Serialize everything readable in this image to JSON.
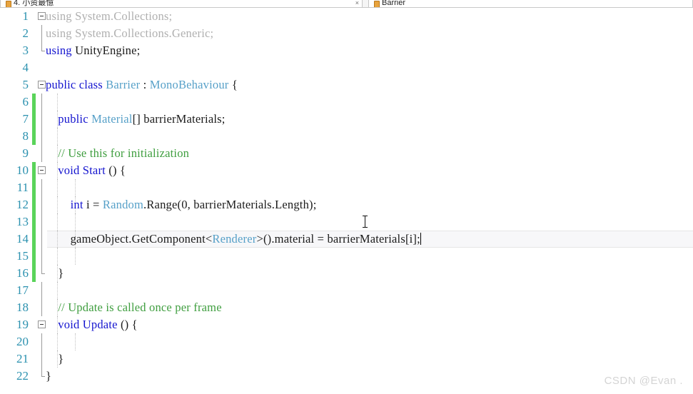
{
  "window": {
    "tabs": [
      {
        "label": "4. 小资最憶",
        "icon": "document-icon",
        "active": false,
        "close_label": "×"
      },
      {
        "label": "Barrier",
        "icon": "csharp-file-icon",
        "active": true,
        "close_label": ""
      }
    ]
  },
  "editor": {
    "file_name": "Barrier",
    "language": "csharp",
    "current_line": 14,
    "colors": {
      "keyword": "#1414cf",
      "type": "#56a0c8",
      "comment": "#3f9e3f",
      "plain": "#1a1a1a",
      "dimmed": "#b0b0b0",
      "line_number": "#2b91af",
      "change_bar": "#5ad45a",
      "current_line_bg": "#f7f7f9"
    },
    "lines": [
      {
        "n": "1",
        "tokens": [
          {
            "t": "using System.Collections;",
            "c": "dim"
          }
        ]
      },
      {
        "n": "2",
        "tokens": [
          {
            "t": "using System.Collections.Generic;",
            "c": "dim"
          }
        ]
      },
      {
        "n": "3",
        "tokens": [
          {
            "t": "using ",
            "c": "kw"
          },
          {
            "t": "UnityEngine;",
            "c": "pl"
          }
        ]
      },
      {
        "n": "4",
        "tokens": [
          {
            "t": "",
            "c": "pl"
          }
        ]
      },
      {
        "n": "5",
        "tokens": [
          {
            "t": "public class ",
            "c": "kw"
          },
          {
            "t": "Barrier",
            "c": "typ"
          },
          {
            "t": " : ",
            "c": "pl"
          },
          {
            "t": "MonoBehaviour",
            "c": "typ"
          },
          {
            "t": " {",
            "c": "pl"
          }
        ]
      },
      {
        "n": "6",
        "tokens": [
          {
            "t": "",
            "c": "pl"
          }
        ]
      },
      {
        "n": "7",
        "tokens": [
          {
            "t": "    public ",
            "c": "kw"
          },
          {
            "t": "Material",
            "c": "typ"
          },
          {
            "t": "[] barrierMaterials;",
            "c": "pl"
          }
        ]
      },
      {
        "n": "8",
        "tokens": [
          {
            "t": "",
            "c": "pl"
          }
        ]
      },
      {
        "n": "9",
        "tokens": [
          {
            "t": "    // Use this for initialization",
            "c": "cmt"
          }
        ]
      },
      {
        "n": "10",
        "tokens": [
          {
            "t": "    void ",
            "c": "kw"
          },
          {
            "t": "Start",
            "c": "kw"
          },
          {
            "t": " () {",
            "c": "pl"
          }
        ]
      },
      {
        "n": "11",
        "tokens": [
          {
            "t": "",
            "c": "pl"
          }
        ]
      },
      {
        "n": "12",
        "tokens": [
          {
            "t": "        int ",
            "c": "kw"
          },
          {
            "t": "i = ",
            "c": "pl"
          },
          {
            "t": "Random",
            "c": "typ"
          },
          {
            "t": ".Range(0, barrierMaterials.Length);",
            "c": "pl"
          }
        ]
      },
      {
        "n": "13",
        "tokens": [
          {
            "t": "",
            "c": "pl"
          }
        ]
      },
      {
        "n": "14",
        "tokens": [
          {
            "t": "        gameObject.GetComponent<",
            "c": "pl"
          },
          {
            "t": "Renderer",
            "c": "typ"
          },
          {
            "t": ">().material = barrierMaterials[i];",
            "c": "pl"
          }
        ]
      },
      {
        "n": "15",
        "tokens": [
          {
            "t": "",
            "c": "pl"
          }
        ]
      },
      {
        "n": "16",
        "tokens": [
          {
            "t": "    }",
            "c": "pl"
          }
        ]
      },
      {
        "n": "17",
        "tokens": [
          {
            "t": "",
            "c": "pl"
          }
        ]
      },
      {
        "n": "18",
        "tokens": [
          {
            "t": "    // Update is called once per frame",
            "c": "cmt"
          }
        ]
      },
      {
        "n": "19",
        "tokens": [
          {
            "t": "    void ",
            "c": "kw"
          },
          {
            "t": "Update",
            "c": "kw"
          },
          {
            "t": " () {",
            "c": "pl"
          }
        ]
      },
      {
        "n": "20",
        "tokens": [
          {
            "t": "",
            "c": "pl"
          }
        ]
      },
      {
        "n": "21",
        "tokens": [
          {
            "t": "    }",
            "c": "pl"
          }
        ]
      },
      {
        "n": "22",
        "tokens": [
          {
            "t": "}",
            "c": "pl"
          }
        ]
      }
    ]
  },
  "watermark": {
    "text": "CSDN @Evan ."
  }
}
